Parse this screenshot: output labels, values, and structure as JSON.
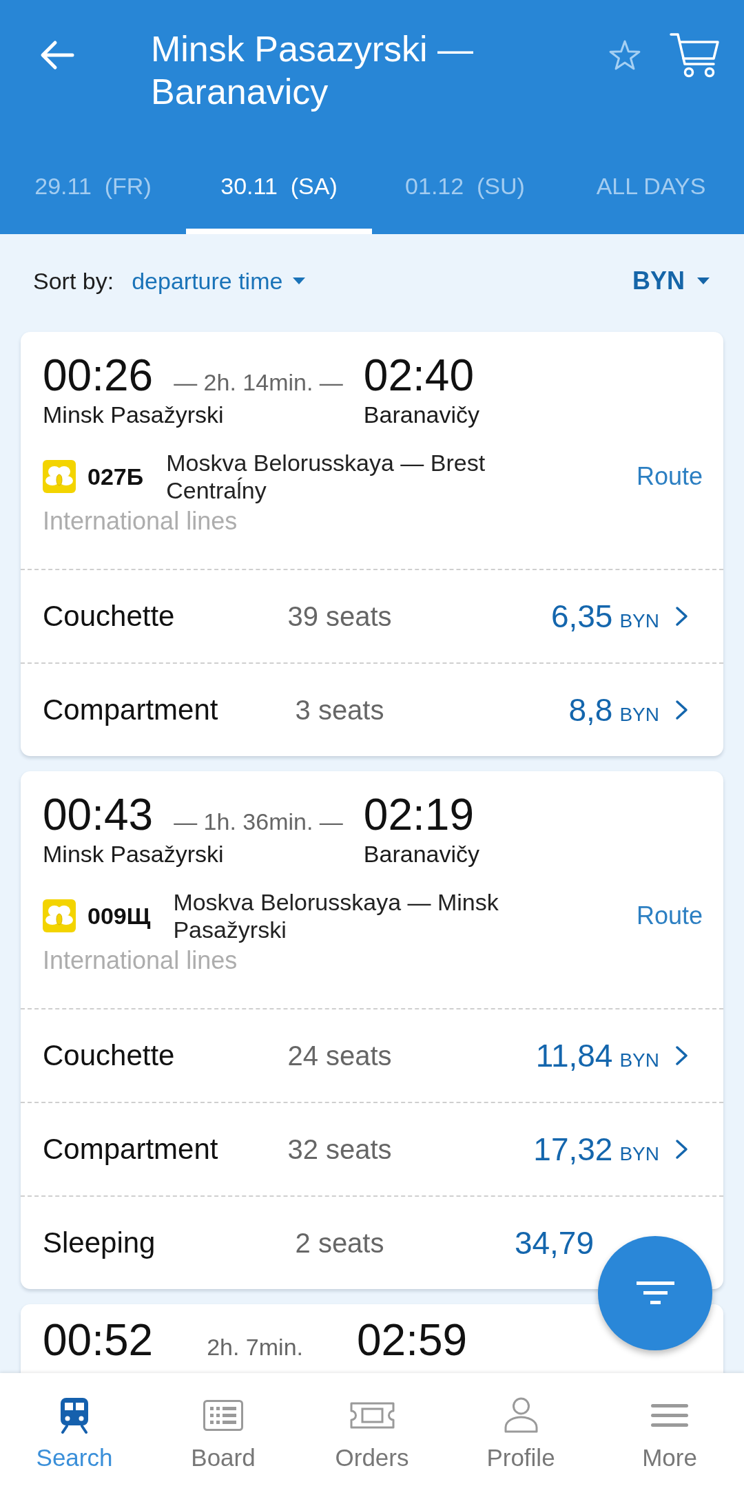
{
  "header": {
    "title": "Minsk Pasazyrski — Baranavicy"
  },
  "tabs": [
    {
      "label": "29.11  (FR)",
      "selected": false
    },
    {
      "label": "30.11  (SA)",
      "selected": true
    },
    {
      "label": "01.12  (SU)",
      "selected": false
    },
    {
      "label": "ALL DAYS",
      "selected": false
    }
  ],
  "sort": {
    "label": "Sort by:",
    "value": "departure time",
    "currency": "BYN"
  },
  "trains": [
    {
      "kind": "full",
      "departure": "00:26",
      "duration": "— 2h. 14min. —",
      "arrival": "02:40",
      "from": "Minsk Pasažyrski",
      "to": "Baranavičy",
      "number": "027Б",
      "route": "Moskva Belorusskaya — Brest Centraĺny",
      "route_link": "Route",
      "category": "International lines",
      "fares": [
        {
          "class": "Couchette",
          "seats": "39 seats",
          "price": "6,35",
          "currency": "BYN"
        },
        {
          "class": "Compartment",
          "seats": "3 seats",
          "price": "8,8",
          "currency": "BYN"
        }
      ]
    },
    {
      "kind": "full",
      "departure": "00:43",
      "duration": "— 1h. 36min. —",
      "arrival": "02:19",
      "from": "Minsk Pasažyrski",
      "to": "Baranavičy",
      "number": "009Щ",
      "route": "Moskva Belorusskaya — Minsk Pasažyrski",
      "route_link": "Route",
      "category": "International lines",
      "fares": [
        {
          "class": "Couchette",
          "seats": "24 seats",
          "price": "11,84",
          "currency": "BYN"
        },
        {
          "class": "Compartment",
          "seats": "32 seats",
          "price": "17,32",
          "currency": "BYN"
        },
        {
          "class": "Sleeping",
          "seats": "2 seats",
          "price": "34,79"
        }
      ]
    },
    {
      "kind": "clipped",
      "departure": "00:52",
      "duration": "2h. 7min.",
      "arrival": "02:59"
    }
  ],
  "bottom_nav": [
    {
      "label": "Search",
      "selected": true
    },
    {
      "label": "Board",
      "selected": false
    },
    {
      "label": "Orders",
      "selected": false
    },
    {
      "label": "Profile",
      "selected": false
    },
    {
      "label": "More",
      "selected": false
    }
  ]
}
